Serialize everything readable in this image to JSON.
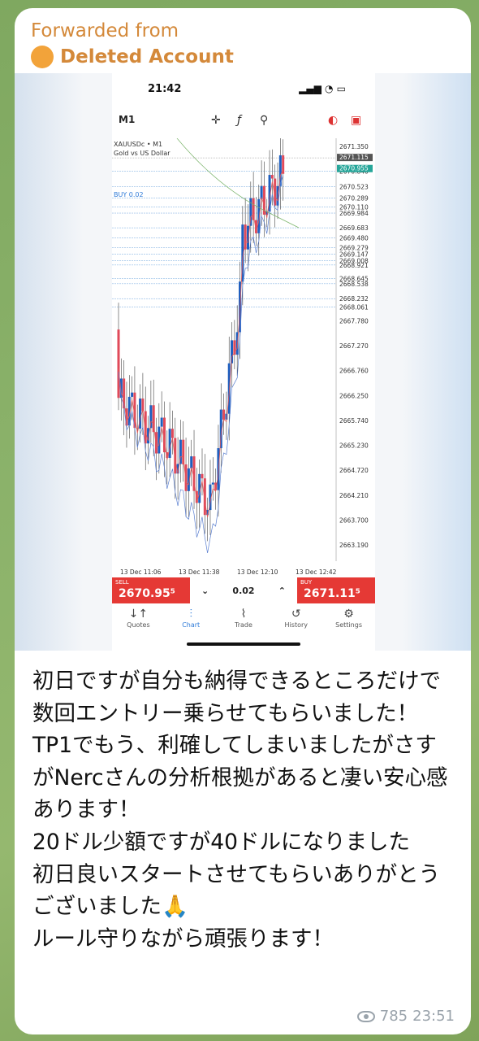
{
  "forward": {
    "from_label": "Forwarded from",
    "account": "Deleted Account"
  },
  "phone": {
    "time": "21:42",
    "timeframe": "M1",
    "symbol": "XAUUSDc • M1",
    "symbol_desc": "Gold vs US Dollar",
    "buy_label": "BUY 0.02",
    "price_ticks": [
      "2671.350",
      "2670.840",
      "2670.523",
      "2670.289",
      "2670.110",
      "2669.984",
      "2669.683",
      "2669.480",
      "2669.279",
      "2669.147",
      "2669.008",
      "2668.921",
      "2668.645",
      "2668.538",
      "2668.232",
      "2668.061",
      "2667.780",
      "2667.270",
      "2666.760",
      "2666.250",
      "2665.740",
      "2665.230",
      "2664.720",
      "2664.210",
      "2663.700",
      "2663.190"
    ],
    "bid_tag": "2671.115",
    "ask_tag": "2670.955",
    "time_ticks": [
      "13 Dec 11:06",
      "13 Dec 11:38",
      "13 Dec 12:10",
      "13 Dec 12:42"
    ],
    "sell": {
      "label": "SELL",
      "price": "2670.95⁵"
    },
    "buy": {
      "label": "BUY",
      "price": "2671.11⁵"
    },
    "lot": "0.02",
    "tabs": [
      {
        "label": "Quotes",
        "icon": "↓↑"
      },
      {
        "label": "Chart",
        "icon": "⫶"
      },
      {
        "label": "Trade",
        "icon": "⌇"
      },
      {
        "label": "History",
        "icon": "↺"
      },
      {
        "label": "Settings",
        "icon": "⚙"
      }
    ]
  },
  "message": "初日ですが自分も納得できるところだけで数回エントリー乗らせてもらいました！TP1でもう、利確してしまいましたがさすがNercさんの分析根拠があると凄い安心感あります！\n20ドル少額ですが40ドルになりました\n初日良いスタートさせてもらいありがとうございました🙏\nルール守りながら頑張ります！",
  "views": "785",
  "time": "23:51",
  "colors": {
    "forward": "#d4893a",
    "sell_buy": "#e53935",
    "accent_blue": "#2f7bd8"
  }
}
